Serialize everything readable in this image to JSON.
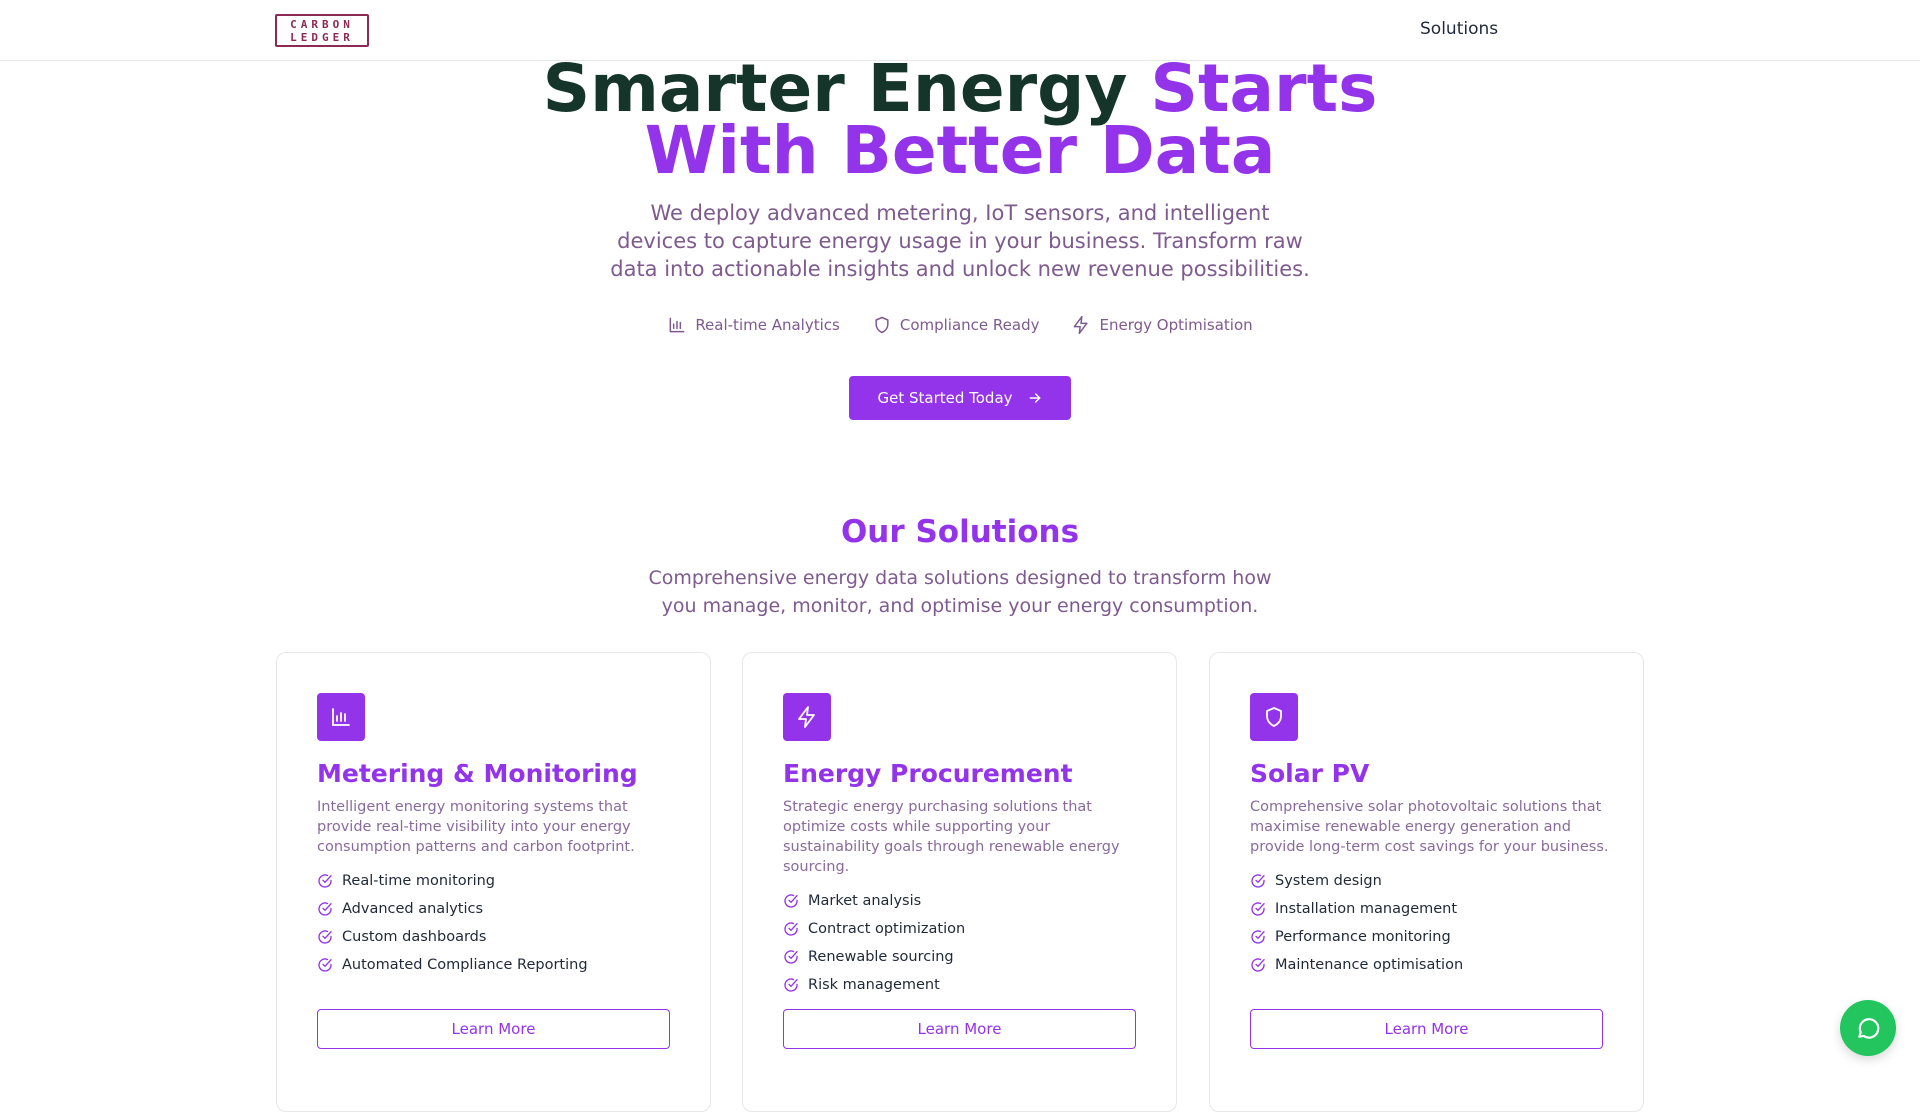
{
  "nav": {
    "logo_line1": "CARBON",
    "logo_line2": "LEDGER",
    "links": [
      "Solutions"
    ]
  },
  "hero": {
    "title_part1": "Smarter Energy ",
    "title_part2": "Starts",
    "title_line2": "With Better Data",
    "subtitle": "We deploy advanced metering, IoT sensors, and intelligent devices to capture energy usage in your business. Transform raw data into actionable insights and unlock new revenue possibilities.",
    "features": [
      {
        "icon": "bar-chart-icon",
        "label": "Real-time Analytics"
      },
      {
        "icon": "shield-icon",
        "label": "Compliance Ready"
      },
      {
        "icon": "lightning-icon",
        "label": "Energy Optimisation"
      }
    ],
    "cta_label": "Get Started Today"
  },
  "solutions": {
    "title": "Our Solutions",
    "subtitle": "Comprehensive energy data solutions designed to transform how you manage, monitor, and optimise your energy consumption.",
    "cards": [
      {
        "icon": "bar-chart-icon",
        "title": "Metering & Monitoring",
        "description": "Intelligent energy monitoring systems that provide real-time visibility into your energy consumption patterns and carbon footprint.",
        "items": [
          "Real-time monitoring",
          "Advanced analytics",
          "Custom dashboards",
          "Automated Compliance Reporting"
        ],
        "button": "Learn More"
      },
      {
        "icon": "lightning-icon",
        "title": "Energy Procurement",
        "description": "Strategic energy purchasing solutions that optimize costs while supporting your sustainability goals through renewable energy sourcing.",
        "items": [
          "Market analysis",
          "Contract optimization",
          "Renewable sourcing",
          "Risk management"
        ],
        "button": "Learn More"
      },
      {
        "icon": "shield-icon",
        "title": "Solar PV",
        "description": "Comprehensive solar photovoltaic solutions that maximise renewable energy generation and provide long-term cost savings for your business.",
        "items": [
          "System design",
          "Installation management",
          "Performance monitoring",
          "Maintenance optimisation"
        ],
        "button": "Learn More"
      }
    ]
  },
  "colors": {
    "accent": "#9333ea",
    "dark_green": "#16352a",
    "muted_purple": "#7e5a8f",
    "chat_green": "#22c55e"
  }
}
